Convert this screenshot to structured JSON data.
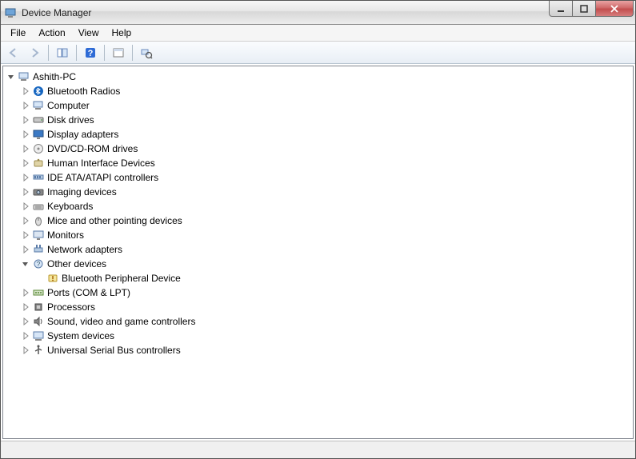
{
  "window": {
    "title": "Device Manager"
  },
  "menu": {
    "file": "File",
    "action": "Action",
    "view": "View",
    "help": "Help"
  },
  "tree": {
    "root": "Ashith-PC",
    "items": [
      {
        "label": "Bluetooth Radios",
        "icon": "bluetooth"
      },
      {
        "label": "Computer",
        "icon": "computer"
      },
      {
        "label": "Disk drives",
        "icon": "disk"
      },
      {
        "label": "Display adapters",
        "icon": "display"
      },
      {
        "label": "DVD/CD-ROM drives",
        "icon": "dvd"
      },
      {
        "label": "Human Interface Devices",
        "icon": "hid"
      },
      {
        "label": "IDE ATA/ATAPI controllers",
        "icon": "ide"
      },
      {
        "label": "Imaging devices",
        "icon": "imaging"
      },
      {
        "label": "Keyboards",
        "icon": "keyboard"
      },
      {
        "label": "Mice and other pointing devices",
        "icon": "mouse"
      },
      {
        "label": "Monitors",
        "icon": "monitor"
      },
      {
        "label": "Network adapters",
        "icon": "network"
      },
      {
        "label": "Other devices",
        "icon": "other",
        "expanded": true,
        "children": [
          {
            "label": "Bluetooth Peripheral Device",
            "icon": "warn"
          }
        ]
      },
      {
        "label": "Ports (COM & LPT)",
        "icon": "ports"
      },
      {
        "label": "Processors",
        "icon": "cpu"
      },
      {
        "label": "Sound, video and game controllers",
        "icon": "sound"
      },
      {
        "label": "System devices",
        "icon": "system"
      },
      {
        "label": "Universal Serial Bus controllers",
        "icon": "usb"
      }
    ]
  }
}
